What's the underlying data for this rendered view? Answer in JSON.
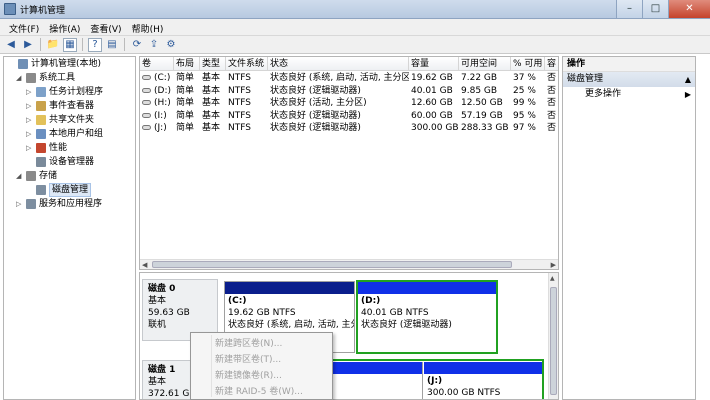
{
  "window": {
    "title": "计算机管理",
    "buttons": {
      "minimize": "–",
      "maximize": "□",
      "close": "✕"
    }
  },
  "menu": [
    "文件(F)",
    "操作(A)",
    "查看(V)",
    "帮助(H)"
  ],
  "toolbar": {
    "icons": [
      "back-icon",
      "forward-icon",
      "up-folder-icon",
      "show-hide-tree-icon",
      "properties-icon",
      "help-icon",
      "refresh-icon",
      "export-icon",
      "view-icon"
    ],
    "glyphs": [
      "◀",
      "▶",
      "📁",
      "▦",
      "?",
      "▤",
      "⟳",
      "⇪",
      "⚙"
    ]
  },
  "tree": {
    "items": [
      {
        "label": "计算机管理(本地)",
        "level": 0,
        "expander": "",
        "icon_color": "#6f8fb5",
        "selected": false
      },
      {
        "label": "系统工具",
        "level": 1,
        "expander": "◢",
        "icon_color": "#8a8a8a",
        "selected": false
      },
      {
        "label": "任务计划程序",
        "level": 2,
        "expander": "▷",
        "icon_color": "#7da1c9",
        "selected": false
      },
      {
        "label": "事件查看器",
        "level": 2,
        "expander": "▷",
        "icon_color": "#c9a24a",
        "selected": false
      },
      {
        "label": "共享文件夹",
        "level": 2,
        "expander": "▷",
        "icon_color": "#e2c15a",
        "selected": false
      },
      {
        "label": "本地用户和组",
        "level": 2,
        "expander": "▷",
        "icon_color": "#6a8fc0",
        "selected": false
      },
      {
        "label": "性能",
        "level": 2,
        "expander": "▷",
        "icon_color": "#c4462e",
        "selected": false
      },
      {
        "label": "设备管理器",
        "level": 2,
        "expander": "",
        "icon_color": "#7a8a9a",
        "selected": false
      },
      {
        "label": "存储",
        "level": 1,
        "expander": "◢",
        "icon_color": "#8a8a8a",
        "selected": false
      },
      {
        "label": "磁盘管理",
        "level": 2,
        "expander": "",
        "icon_color": "#7d8ea0",
        "selected": true
      },
      {
        "label": "服务和应用程序",
        "level": 1,
        "expander": "▷",
        "icon_color": "#7d8ea0",
        "selected": false
      }
    ]
  },
  "volumes": {
    "columns": [
      "卷",
      "布局",
      "类型",
      "文件系统",
      "状态",
      "容量",
      "可用空间",
      "% 可用",
      "容"
    ],
    "rows": [
      [
        "(C:)",
        "简单",
        "基本",
        "NTFS",
        "状态良好 (系统, 启动, 活动, 主分区)",
        "19.62 GB",
        "7.22 GB",
        "37 %",
        "否"
      ],
      [
        "(D:)",
        "简单",
        "基本",
        "NTFS",
        "状态良好 (逻辑驱动器)",
        "40.01 GB",
        "9.85 GB",
        "25 %",
        "否"
      ],
      [
        "(H:)",
        "简单",
        "基本",
        "NTFS",
        "状态良好 (活动, 主分区)",
        "12.60 GB",
        "12.50 GB",
        "99 %",
        "否"
      ],
      [
        "(I:)",
        "简单",
        "基本",
        "NTFS",
        "状态良好 (逻辑驱动器)",
        "60.00 GB",
        "57.19 GB",
        "95 %",
        "否"
      ],
      [
        "(J:)",
        "简单",
        "基本",
        "NTFS",
        "状态良好 (逻辑驱动器)",
        "300.00 GB",
        "288.33 GB",
        "97 %",
        "否"
      ]
    ]
  },
  "actions": {
    "header": "操作",
    "section": "磁盘管理",
    "section_caret": "▲",
    "items": [
      {
        "label": "更多操作",
        "caret": "▶"
      }
    ]
  },
  "disks": [
    {
      "name": "磁盘 0",
      "type": "基本",
      "size": "59.63 GB",
      "status": "联机"
    },
    {
      "name": "磁盘 1",
      "type": "基本",
      "size": "372.61 GB",
      "status": ""
    }
  ],
  "partitions": [
    {
      "name": "(C:)",
      "size": "19.62 GB NTFS",
      "status": "状态良好 (系统, 启动, 活动, 主分区",
      "bar_color": "#0a1e8c"
    },
    {
      "name": "(D:)",
      "size": "40.01 GB NTFS",
      "status": "状态良好 (逻辑驱动器)",
      "bar_color": "#1030e8"
    },
    {
      "name": "",
      "size": "",
      "status": "",
      "bar_color": "#1030e8"
    },
    {
      "name": "(J:)",
      "size": "300.00 GB NTFS",
      "status": "",
      "bar_color": "#1030e8"
    }
  ],
  "context_menu": {
    "items": [
      "新建跨区卷(N)...",
      "新建带区卷(T)...",
      "新建镜像卷(R)...",
      "新建 RAID-5 卷(W)..."
    ]
  }
}
